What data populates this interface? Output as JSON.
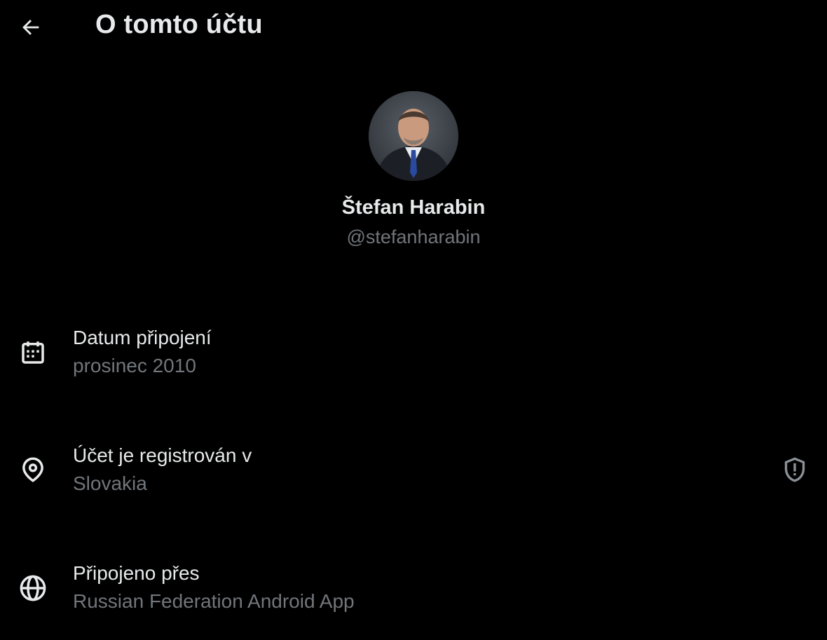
{
  "header": {
    "title": "O tomto účtu"
  },
  "profile": {
    "display_name": "Štefan Harabin",
    "handle": "@stefanharabin"
  },
  "rows": [
    {
      "label": "Datum připojení",
      "value": "prosinec 2010",
      "icon": "calendar-icon"
    },
    {
      "label": "Účet je registrován v",
      "value": "Slovakia",
      "icon": "location-pin-icon",
      "side_icon": "shield-alert-icon"
    },
    {
      "label": "Připojeno přes",
      "value": "Russian Federation Android App",
      "icon": "globe-icon"
    }
  ],
  "colors": {
    "background": "#000000",
    "text": "#e7e9ea",
    "muted": "#71767b"
  }
}
